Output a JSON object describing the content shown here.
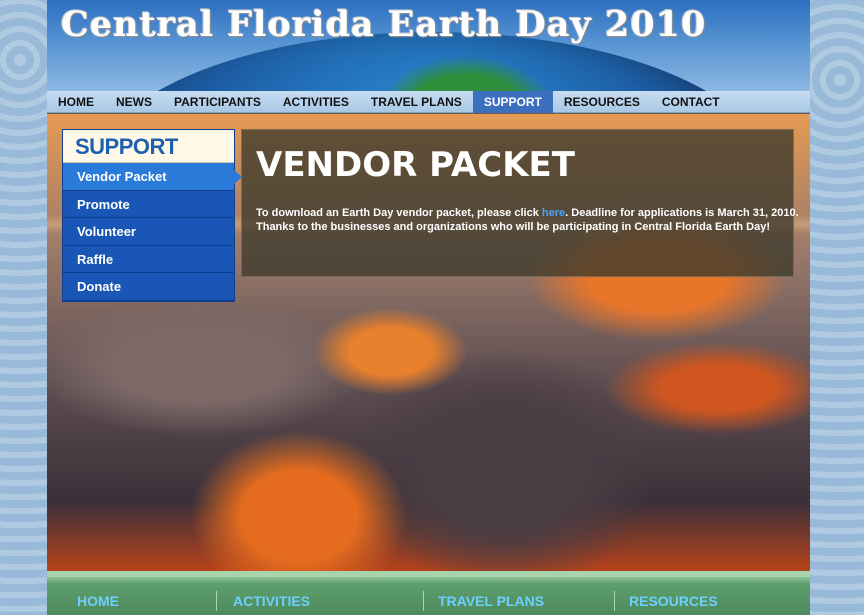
{
  "site": {
    "title": "Central Florida Earth Day 2010"
  },
  "nav": {
    "items": [
      "HOME",
      "NEWS",
      "PARTICIPANTS",
      "ACTIVITIES",
      "TRAVEL PLANS",
      "SUPPORT",
      "RESOURCES",
      "CONTACT"
    ],
    "active": "SUPPORT"
  },
  "sidebar": {
    "heading": "SUPPORT",
    "items": [
      "Vendor Packet",
      "Promote",
      "Volunteer",
      "Raffle",
      "Donate"
    ],
    "active": "Vendor Packet"
  },
  "content": {
    "title": "VENDOR PACKET",
    "line1_before": "To download an Earth Day vendor packet, please click ",
    "line1_link": "here",
    "line1_after": ". Deadline for applications is March 31, 2010.",
    "line2": "Thanks to the businesses and organizations who will be participating in Central Florida Earth Day!"
  },
  "footer": {
    "links": [
      "HOME",
      "ACTIVITIES",
      "TRAVEL PLANS",
      "RESOURCES"
    ]
  },
  "colors": {
    "nav_active": "#3d6fbf",
    "sidebar_bg": "#1a56b5",
    "sidebar_active": "#2a7ad9",
    "link": "#4aa3ff",
    "footer_link": "#6fd0ff"
  }
}
